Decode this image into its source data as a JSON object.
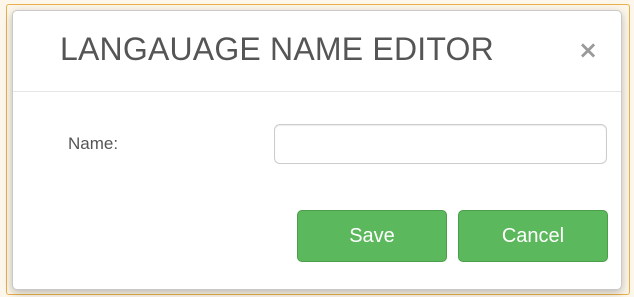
{
  "dialog": {
    "title": "LANGAUAGE NAME EDITOR",
    "close_label": "×"
  },
  "form": {
    "name_label": "Name:",
    "name_value": "",
    "name_placeholder": ""
  },
  "buttons": {
    "save_label": "Save",
    "cancel_label": "Cancel"
  },
  "colors": {
    "button_green": "#5cb85c",
    "title_text": "#555555",
    "frame_border": "#e9b04c"
  }
}
